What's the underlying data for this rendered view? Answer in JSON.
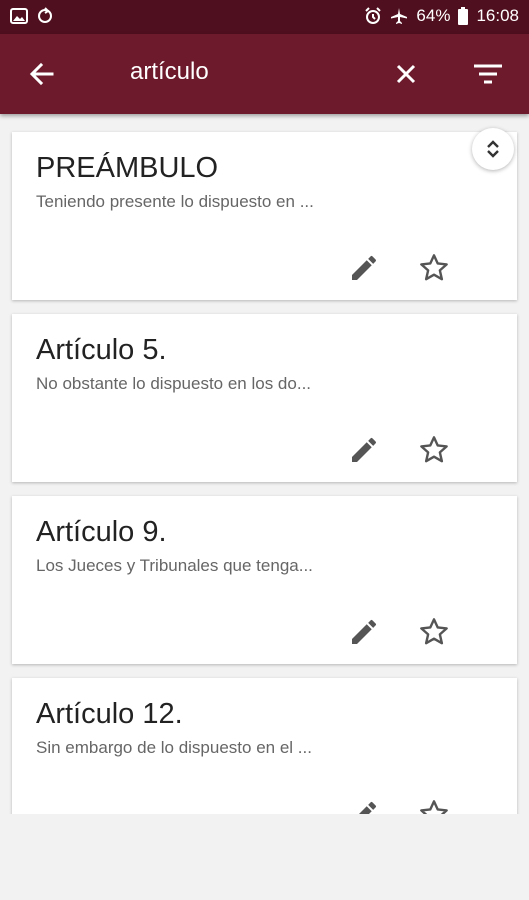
{
  "status_bar": {
    "battery_percent": "64%",
    "time": "16:08",
    "icons": [
      "gallery-icon",
      "sync-icon",
      "alarm-icon",
      "airplane-icon",
      "battery-icon"
    ]
  },
  "app_bar": {
    "query": "artículo",
    "icons": [
      "back-arrow-icon",
      "close-icon",
      "filter-icon"
    ],
    "color": "#6d1a2c"
  },
  "results": [
    {
      "title": "PREÁMBULO",
      "snippet": "Teniendo presente lo dispuesto en ..."
    },
    {
      "title": "Artículo 5.",
      "snippet": "No obstante lo dispuesto en los do..."
    },
    {
      "title": "Artículo 9.",
      "snippet": "Los Jueces y Tribunales que tenga..."
    },
    {
      "title": "Artículo 12.",
      "snippet": "Sin embargo de lo dispuesto en el ..."
    }
  ]
}
